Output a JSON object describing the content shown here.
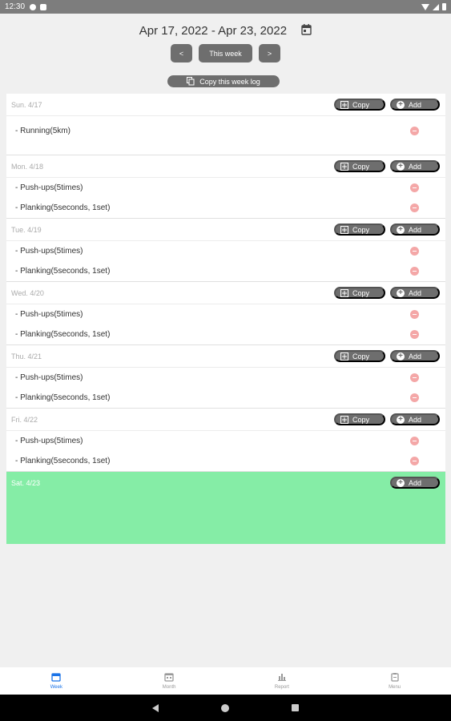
{
  "status_bar": {
    "time": "12:30"
  },
  "header": {
    "date_range": "Apr 17, 2022 - Apr 23, 2022",
    "prev_label": "<",
    "this_week_label": "This week",
    "next_label": ">",
    "copy_week_label": "Copy this week log"
  },
  "days": [
    {
      "label": "Sun. 4/17",
      "copy_label": "Copy",
      "add_label": "Add",
      "entries": [
        "- Running(5km)"
      ]
    },
    {
      "label": "Mon. 4/18",
      "copy_label": "Copy",
      "add_label": "Add",
      "entries": [
        "- Push-ups(5times)",
        "- Planking(5seconds, 1set)"
      ]
    },
    {
      "label": "Tue. 4/19",
      "copy_label": "Copy",
      "add_label": "Add",
      "entries": [
        "- Push-ups(5times)",
        "- Planking(5seconds, 1set)"
      ]
    },
    {
      "label": "Wed. 4/20",
      "copy_label": "Copy",
      "add_label": "Add",
      "entries": [
        "- Push-ups(5times)",
        "- Planking(5seconds, 1set)"
      ]
    },
    {
      "label": "Thu. 4/21",
      "copy_label": "Copy",
      "add_label": "Add",
      "entries": [
        "- Push-ups(5times)",
        "- Planking(5seconds, 1set)"
      ]
    },
    {
      "label": "Fri. 4/22",
      "copy_label": "Copy",
      "add_label": "Add",
      "entries": [
        "- Push-ups(5times)",
        "- Planking(5seconds, 1set)"
      ]
    },
    {
      "label": "Sat. 4/23",
      "add_label": "Add",
      "entries": [],
      "highlighted": true
    }
  ],
  "bottom_nav": [
    {
      "label": "Week",
      "icon": "calendar-week-icon",
      "active": true
    },
    {
      "label": "Month",
      "icon": "calendar-month-icon",
      "active": false
    },
    {
      "label": "Report",
      "icon": "bar-chart-icon",
      "active": false
    },
    {
      "label": "Menu",
      "icon": "clipboard-icon",
      "active": false
    }
  ],
  "colors": {
    "today_bg": "#85eda6",
    "button_bg": "#6e6e6e",
    "delete": "#f4a7a7",
    "active_tab": "#1a73e8"
  }
}
